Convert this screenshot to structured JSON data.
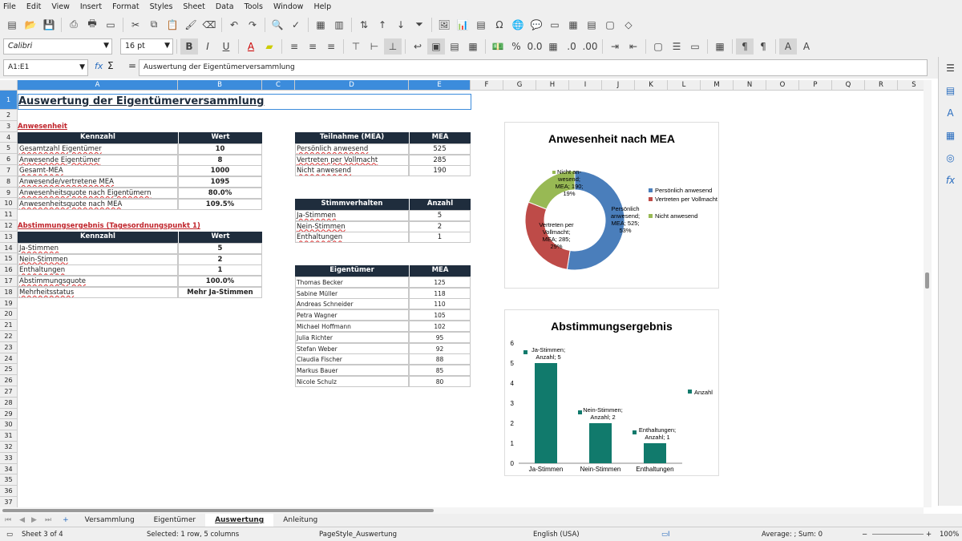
{
  "menu": [
    "File",
    "Edit",
    "View",
    "Insert",
    "Format",
    "Styles",
    "Sheet",
    "Data",
    "Tools",
    "Window",
    "Help"
  ],
  "font": {
    "name": "Calibri",
    "size": "16 pt"
  },
  "namebox": "A1:E1",
  "formula": "Auswertung der Eigentümerversammlung",
  "columns": [
    "A",
    "B",
    "C",
    "D",
    "E",
    "F",
    "G",
    "H",
    "I",
    "J",
    "K",
    "L",
    "M",
    "N",
    "O",
    "P",
    "Q",
    "R",
    "S"
  ],
  "rows": [
    "1",
    "2",
    "3",
    "4",
    "5",
    "6",
    "7",
    "8",
    "9",
    "10",
    "11",
    "12",
    "13",
    "14",
    "15",
    "16",
    "17",
    "18",
    "19",
    "20",
    "21",
    "22",
    "23",
    "24",
    "25",
    "26",
    "27",
    "28",
    "29",
    "30",
    "31",
    "32",
    "33",
    "34",
    "35",
    "36",
    "37"
  ],
  "title": "Auswertung der Eigentümerversammlung",
  "anwesenheit": {
    "heading": "Anwesenheit",
    "col1": "Kennzahl",
    "col2": "Wert",
    "rows": [
      [
        "Gesamtzahl Eigentümer",
        "10"
      ],
      [
        "Anwesende Eigentümer",
        "8"
      ],
      [
        "Gesamt-MEA",
        "1000"
      ],
      [
        "Anwesende/vertretene MEA",
        "1095"
      ],
      [
        "Anwesenheitsquote nach Eigentümern",
        "80.0%"
      ],
      [
        "Anwesenheitsquote nach MEA",
        "109.5%"
      ]
    ]
  },
  "abstimmung": {
    "heading": "Abstimmungsergebnis (Tagesordnungspunkt 1)",
    "col1": "Kennzahl",
    "col2": "Wert",
    "rows": [
      [
        "Ja-Stimmen",
        "5"
      ],
      [
        "Nein-Stimmen",
        "2"
      ],
      [
        "Enthaltungen",
        "1"
      ],
      [
        "Abstimmungsquote",
        "100.0%"
      ],
      [
        "Mehrheitsstatus",
        "Mehr Ja-Stimmen"
      ]
    ]
  },
  "teilnahme": {
    "col1": "Teilnahme (MEA)",
    "col2": "MEA",
    "rows": [
      [
        "Persönlich anwesend",
        "525"
      ],
      [
        "Vertreten per Vollmacht",
        "285"
      ],
      [
        "Nicht anwesend",
        "190"
      ]
    ]
  },
  "stimm": {
    "col1": "Stimmverhalten",
    "col2": "Anzahl",
    "rows": [
      [
        "Ja-Stimmen",
        "5"
      ],
      [
        "Nein-Stimmen",
        "2"
      ],
      [
        "Enthaltungen",
        "1"
      ]
    ]
  },
  "eigent": {
    "col1": "Eigentümer",
    "col2": "MEA",
    "rows": [
      [
        "Thomas Becker",
        "125"
      ],
      [
        "Sabine Müller",
        "118"
      ],
      [
        "Andreas Schneider",
        "110"
      ],
      [
        "Petra Wagner",
        "105"
      ],
      [
        "Michael Hoffmann",
        "102"
      ],
      [
        "Julia Richter",
        "95"
      ],
      [
        "Stefan Weber",
        "92"
      ],
      [
        "Claudia Fischer",
        "88"
      ],
      [
        "Markus Bauer",
        "85"
      ],
      [
        "Nicole Schulz",
        "80"
      ]
    ]
  },
  "chart_data": [
    {
      "type": "pie",
      "title": "Anwesenheit nach MEA",
      "categories": [
        "Persönlich anwesend",
        "Vertreten per Vollmacht",
        "Nicht anwesend"
      ],
      "values": [
        525,
        285,
        190
      ],
      "percents": [
        "53%",
        "29%",
        "19%"
      ],
      "colors": [
        "#4a7ebb",
        "#be4b48",
        "#98b954"
      ],
      "legend": "right",
      "labels": [
        [
          "Persönlich",
          "anwesend;",
          "MEA; 525;",
          "53%"
        ],
        [
          "Vertreten per",
          "Vollmacht;",
          "MEA; 285;",
          "29%"
        ],
        [
          "Nicht an-",
          "wesend;",
          "MEA; 190;",
          "19%"
        ]
      ]
    },
    {
      "type": "bar",
      "title": "Abstimmungsergebnis",
      "categories": [
        "Ja-Stimmen",
        "Nein-Stimmen",
        "Enthaltungen"
      ],
      "series": [
        {
          "name": "Anzahl",
          "values": [
            5,
            2,
            1
          ]
        }
      ],
      "ylim": [
        0,
        6
      ],
      "yticks": [
        "0",
        "1",
        "2",
        "3",
        "4",
        "5",
        "6"
      ],
      "color": "#117a6c",
      "labels": [
        [
          "Ja-Stimmen;",
          "Anzahl; 5"
        ],
        [
          "Nein-Stimmen;",
          "Anzahl; 2"
        ],
        [
          "Enthaltungen;",
          "Anzahl; 1"
        ]
      ]
    }
  ],
  "sheets": [
    "Versammlung",
    "Eigentümer",
    "Auswertung",
    "Anleitung"
  ],
  "status": {
    "sheet": "Sheet 3 of 4",
    "selection": "Selected: 1 row, 5 columns",
    "pagestyle": "PageStyle_Auswertung",
    "lang": "English (USA)",
    "sum": "Average: ; Sum: 0",
    "zoom": "100%"
  }
}
